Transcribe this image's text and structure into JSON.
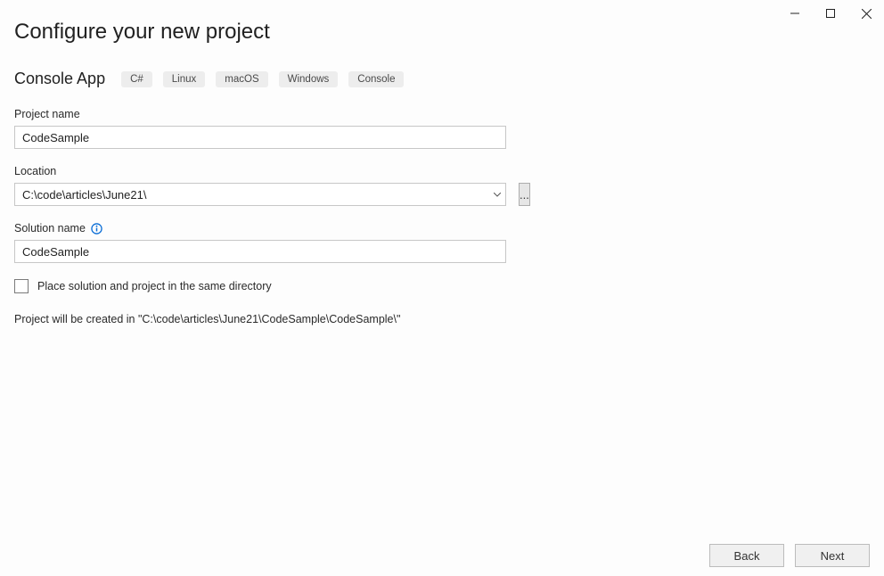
{
  "window": {
    "title": "Configure your new project"
  },
  "project_type": "Console App",
  "tags": [
    "C#",
    "Linux",
    "macOS",
    "Windows",
    "Console"
  ],
  "form": {
    "project_name_label": "Project name",
    "project_name_value": "CodeSample",
    "location_label": "Location",
    "location_value": "C:\\code\\articles\\June21\\",
    "browse_label": "...",
    "solution_name_label": "Solution name",
    "solution_name_value": "CodeSample",
    "same_dir_label": "Place solution and project in the same directory",
    "same_dir_checked": false,
    "summary_text": "Project will be created in \"C:\\code\\articles\\June21\\CodeSample\\CodeSample\\\""
  },
  "footer": {
    "back_label": "Back",
    "next_label": "Next"
  }
}
